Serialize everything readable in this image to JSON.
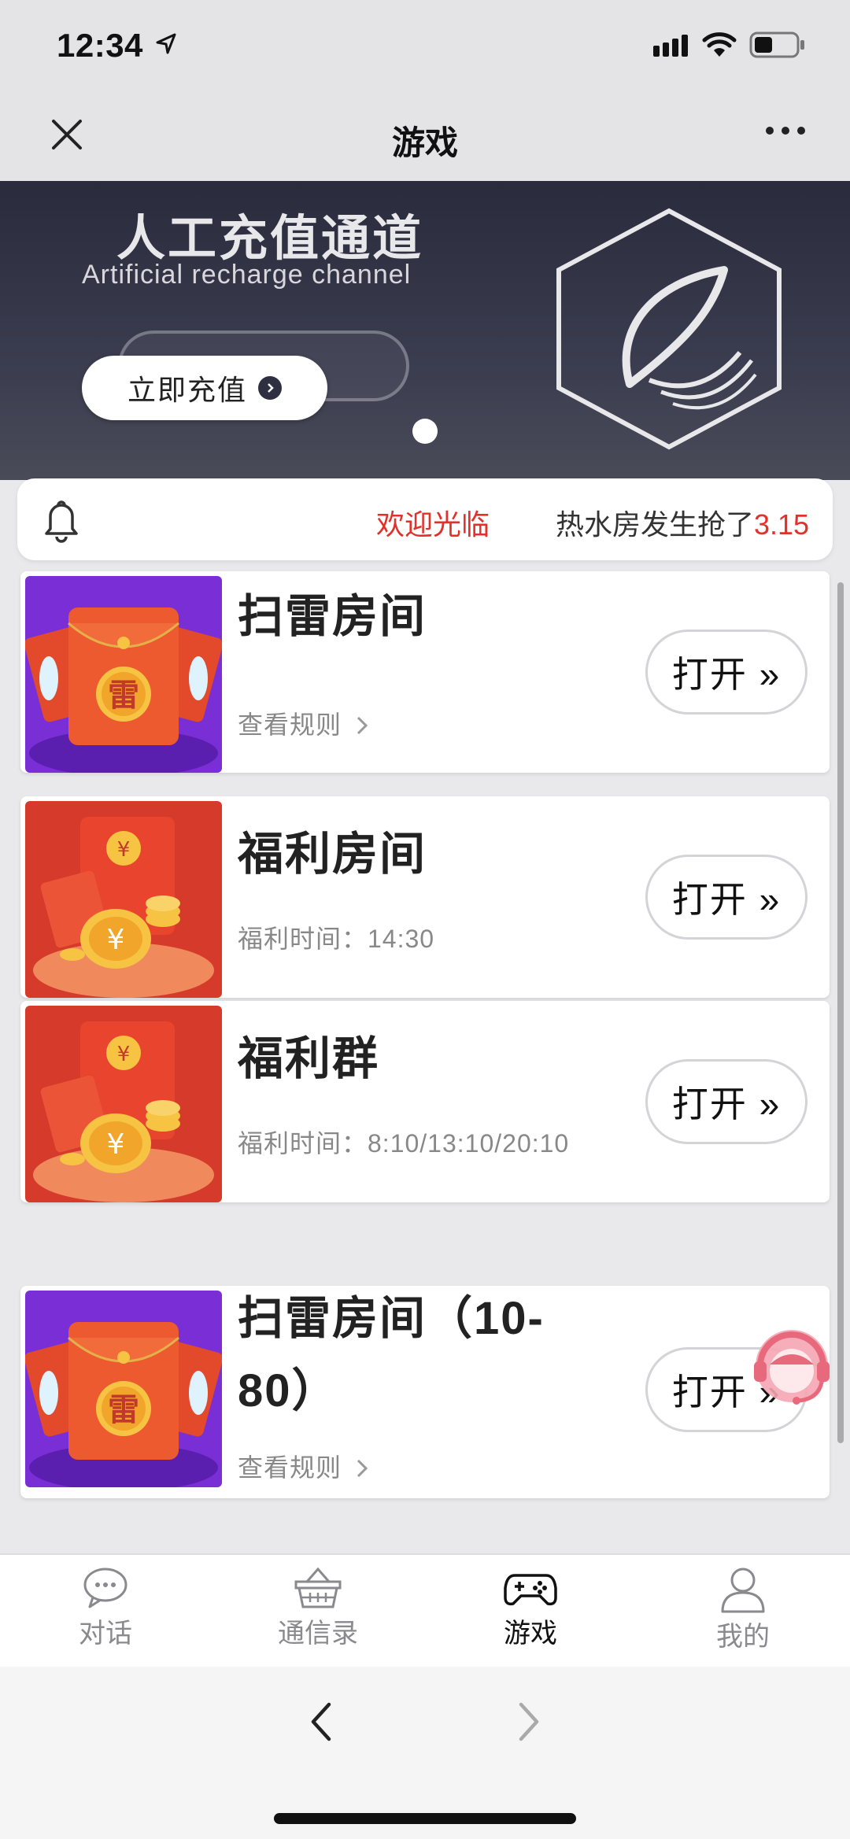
{
  "status_bar": {
    "time": "12:34"
  },
  "nav": {
    "title": "游戏"
  },
  "banner": {
    "title": "人工充值通道",
    "subtitle": "Artificial recharge channel",
    "button_label": "立即充值"
  },
  "notice": {
    "welcome": "欢迎光临",
    "message": "热水房发生抢了",
    "amount": "3.15"
  },
  "games": [
    {
      "title": "扫雷房间",
      "subtitle": "查看规则",
      "button": "打开 »"
    },
    {
      "title": "福利房间",
      "subtitle": "福利时间：14:30",
      "button": "打开 »"
    },
    {
      "title": "福利群",
      "subtitle": "福利时间：8:10/13:10/20:10",
      "button": "打开 »"
    },
    {
      "title_line1": "扫雷房间（10-",
      "title_line2": "80）",
      "subtitle": "查看规则",
      "button": "打开 »"
    }
  ],
  "thumb_labels": {
    "lei": "雷",
    "yen": "¥"
  },
  "tabs": [
    {
      "label": "对话",
      "icon": "chat-icon"
    },
    {
      "label": "通信录",
      "icon": "basket-icon"
    },
    {
      "label": "游戏",
      "icon": "gamepad-icon",
      "active": true
    },
    {
      "label": "我的",
      "icon": "user-icon"
    }
  ],
  "colors": {
    "accent_red": "#e0312b",
    "banner_dark": "#2a2c3d",
    "purple_thumb": "#7a2fd6",
    "red_thumb": "#d63a2a"
  }
}
